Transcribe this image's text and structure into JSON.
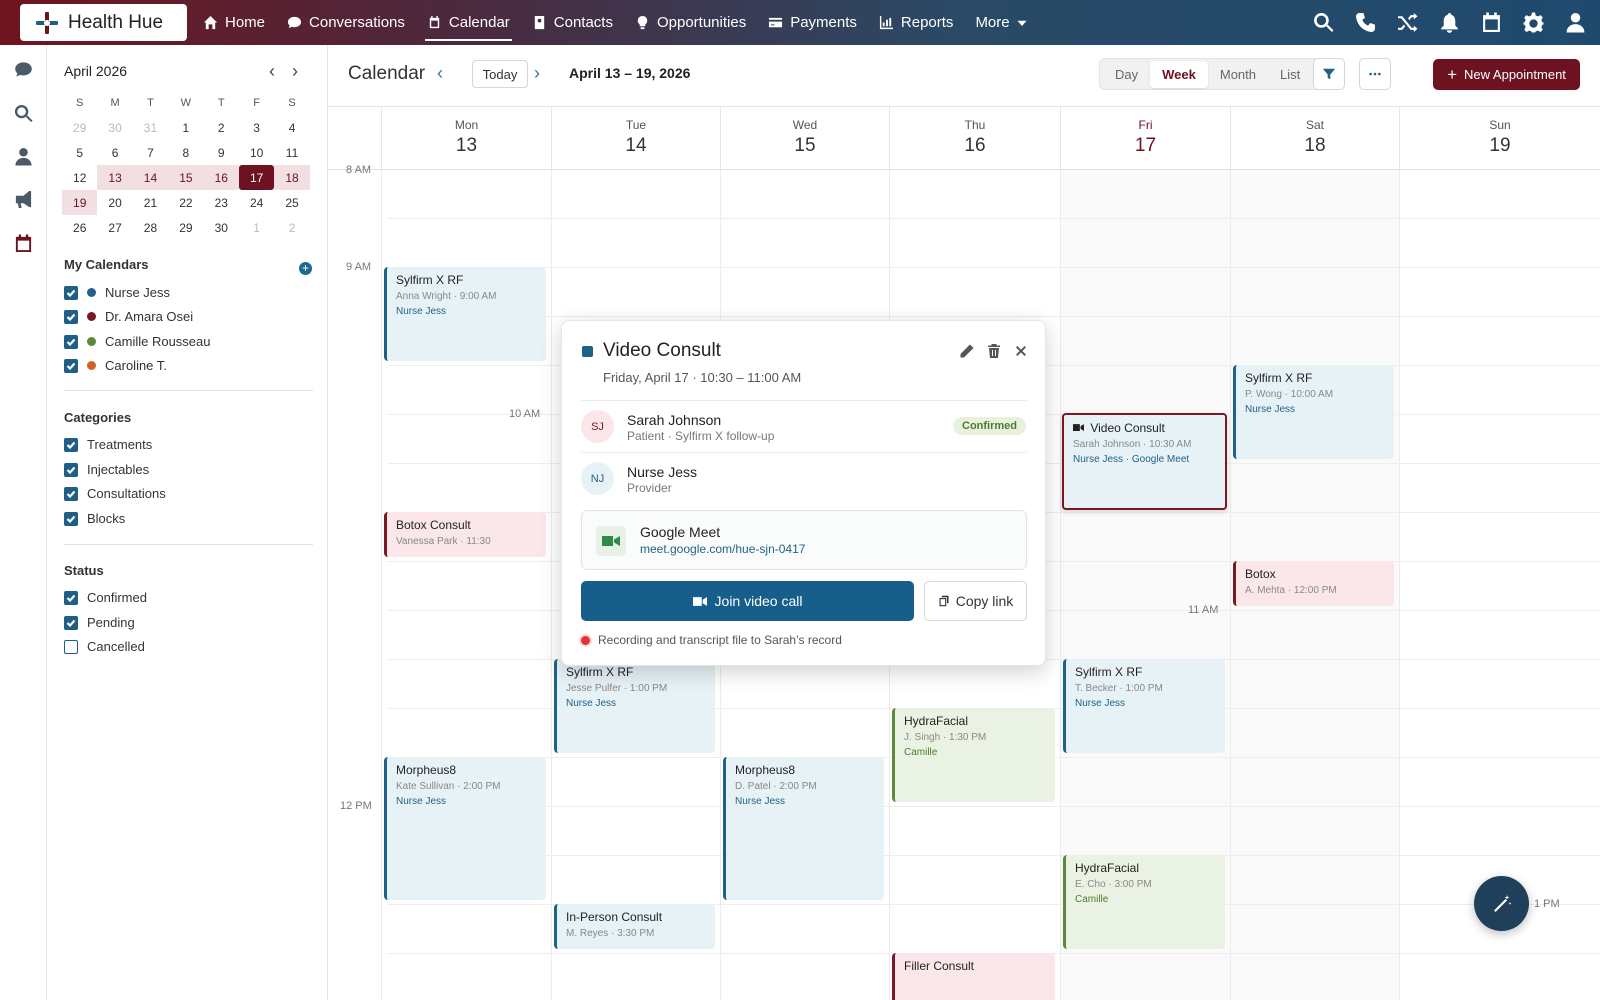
{
  "app": {
    "name": "Health Hue"
  },
  "nav": {
    "items": [
      {
        "label": "Home",
        "icon": "home-icon"
      },
      {
        "label": "Conversations",
        "icon": "chat-icon"
      },
      {
        "label": "Calendar",
        "icon": "calendar-icon",
        "active": true
      },
      {
        "label": "Contacts",
        "icon": "contacts-icon"
      },
      {
        "label": "Opportunities",
        "icon": "lightbulb-icon"
      },
      {
        "label": "Payments",
        "icon": "card-icon"
      },
      {
        "label": "Reports",
        "icon": "chart-icon"
      },
      {
        "label": "More",
        "icon": "chevron-down-icon"
      }
    ],
    "right_icons": [
      "search-icon",
      "phone-icon",
      "shuffle-icon",
      "bell-icon",
      "calendar-icon",
      "gear-icon",
      "user-icon"
    ]
  },
  "rail_icons": [
    "chat-icon",
    "search-icon",
    "user-icon",
    "megaphone-icon",
    "calendar-icon"
  ],
  "mini_calendar": {
    "title": "April 2026",
    "dow": [
      "S",
      "M",
      "T",
      "W",
      "T",
      "F",
      "S"
    ],
    "weeks": [
      [
        "29",
        "30",
        "31",
        "1",
        "2",
        "3",
        "4"
      ],
      [
        "5",
        "6",
        "7",
        "8",
        "9",
        "10",
        "11"
      ],
      [
        "12",
        "13",
        "14",
        "15",
        "16",
        "17",
        "18"
      ],
      [
        "19",
        "20",
        "21",
        "22",
        "23",
        "24",
        "25"
      ],
      [
        "26",
        "27",
        "28",
        "29",
        "30",
        "1",
        "2"
      ]
    ],
    "selected": "17"
  },
  "my_calendars": {
    "title": "My Calendars",
    "items": [
      {
        "label": "Nurse Jess",
        "color": "#1f6288"
      },
      {
        "label": "Dr. Amara Osei",
        "color": "#7a1824"
      },
      {
        "label": "Camille Rousseau",
        "color": "#5c8a3a"
      },
      {
        "label": "Caroline T.",
        "color": "#d0612a"
      }
    ]
  },
  "categories": {
    "title": "Categories",
    "items": [
      "Treatments",
      "Injectables",
      "Consultations",
      "Blocks"
    ]
  },
  "status": {
    "title": "Status",
    "items": [
      {
        "label": "Confirmed",
        "checked": true
      },
      {
        "label": "Pending",
        "checked": true
      },
      {
        "label": "Cancelled",
        "checked": false
      }
    ]
  },
  "toolbar": {
    "title": "Calendar",
    "today": "Today",
    "range": "April 13 – 19, 2026",
    "views": [
      "Day",
      "Week",
      "Month",
      "List"
    ],
    "active_view": "Week",
    "new_appointment": "New Appointment"
  },
  "days": [
    {
      "name": "Mon",
      "date": "13"
    },
    {
      "name": "Tue",
      "date": "14"
    },
    {
      "name": "Wed",
      "date": "15"
    },
    {
      "name": "Thu",
      "date": "16"
    },
    {
      "name": "Fri",
      "date": "17",
      "today": true
    },
    {
      "name": "Sat",
      "date": "18"
    },
    {
      "name": "Sun",
      "date": "19"
    }
  ],
  "time_labels": [
    "8 AM",
    "9 AM",
    "10 AM",
    "11 AM",
    "12 PM",
    "1 PM"
  ],
  "events": [
    {
      "title": "Sylfirm X RF",
      "sub": "Anna Wright · 9:00 AM",
      "provider": "Nurse Jess",
      "kind": "blue"
    },
    {
      "title": "Botox Consult",
      "sub": "Vanessa Park · 11:30",
      "provider": "",
      "kind": "pink"
    },
    {
      "title": "Morpheus8",
      "sub": "Kate Sullivan · 2:00 PM",
      "provider": "Nurse Jess",
      "kind": "blue"
    },
    {
      "title": "Sylfirm X RF",
      "sub": "Jesse Pulfer · 1:00 PM",
      "provider": "Nurse Jess",
      "kind": "blue"
    },
    {
      "title": "In-Person Consult",
      "sub": "M. Reyes · 3:30 PM",
      "provider": "",
      "kind": "blue"
    },
    {
      "title": "Morpheus8",
      "sub": "D. Patel · 2:00 PM",
      "provider": "Nurse Jess",
      "kind": "blue"
    },
    {
      "title": "HydraFacial",
      "sub": "J. Singh · 1:30 PM",
      "provider": "Camille",
      "kind": "green"
    },
    {
      "title": "Filler Consult",
      "sub": "",
      "provider": "",
      "kind": "pink"
    },
    {
      "title": "Video Consult",
      "sub": "Sarah Johnson · 10:30 AM",
      "provider": "Nurse Jess · Google Meet",
      "kind": "sel"
    },
    {
      "title": "Sylfirm X RF",
      "sub": "T. Becker · 1:00 PM",
      "provider": "Nurse Jess",
      "kind": "blue"
    },
    {
      "title": "HydraFacial",
      "sub": "E. Cho · 3:00 PM",
      "provider": "Camille",
      "kind": "green"
    },
    {
      "title": "Sylfirm X RF",
      "sub": "P. Wong · 10:00 AM",
      "provider": "Nurse Jess",
      "kind": "blue"
    },
    {
      "title": "Botox",
      "sub": "A. Mehta · 12:00 PM",
      "provider": "",
      "kind": "pink"
    }
  ],
  "popover": {
    "title": "Video Consult",
    "when": "Friday, April 17 · 10:30 – 11:00 AM",
    "patient": {
      "initials": "SJ",
      "name": "Sarah Johnson",
      "role": "Patient · Sylfirm X follow-up",
      "status": "Confirmed"
    },
    "provider": {
      "initials": "NJ",
      "name": "Nurse Jess",
      "role": "Provider"
    },
    "meet": {
      "name": "Google Meet",
      "link": "meet.google.com/hue-sjn-0417"
    },
    "join": "Join video call",
    "copy": "Copy link",
    "recording": "Recording and transcript file to Sarah’s record"
  }
}
